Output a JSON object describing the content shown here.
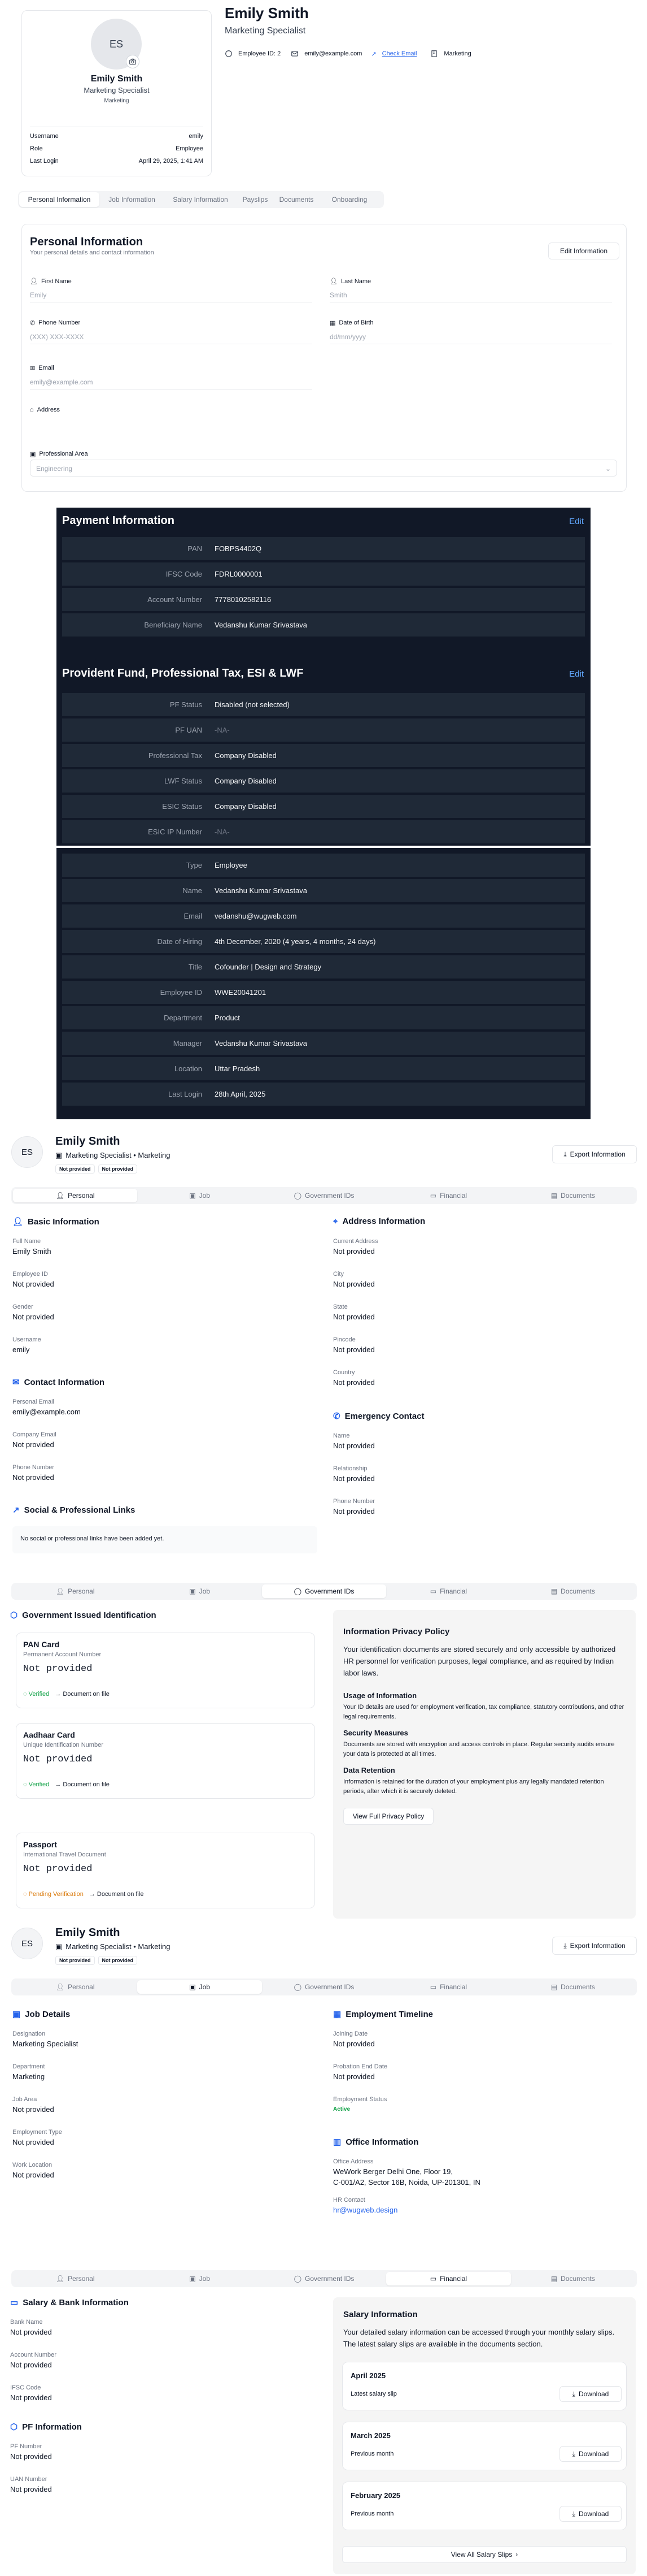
{
  "profile_card": {
    "initials": "ES",
    "name": "Emily Smith",
    "role": "Marketing Specialist",
    "department": "Marketing",
    "rows": [
      {
        "k": "Username",
        "v": "emily"
      },
      {
        "k": "Role",
        "v": "Employee"
      },
      {
        "k": "Last Login",
        "v": "April 29, 2025, 1:41 AM"
      }
    ]
  },
  "header": {
    "name": "Emily Smith",
    "role": "Marketing Specialist",
    "employee_id": "Employee ID: 2",
    "email": "emily@example.com",
    "check_email": "Check Email",
    "department": "Marketing"
  },
  "tabs1": [
    "Personal Information",
    "Job Information",
    "Salary Information",
    "Payslips",
    "Documents",
    "Onboarding"
  ],
  "personal_form": {
    "title": "Personal Information",
    "subtitle": "Your personal details and contact information",
    "edit": "Edit Information",
    "first_name_label": "First Name",
    "first_name": "Emily",
    "last_name_label": "Last Name",
    "last_name": "Smith",
    "phone_label": "Phone Number",
    "phone_placeholder": "(XXX) XXX-XXXX",
    "dob_label": "Date of Birth",
    "dob_placeholder": "dd/mm/yyyy",
    "email_label": "Email",
    "email": "emily@example.com",
    "address_label": "Address",
    "area_label": "Professional Area",
    "area": "Engineering"
  },
  "payment": {
    "title": "Payment Information",
    "edit": "Edit",
    "rows": [
      {
        "k": "PAN",
        "v": "FOBPS4402Q"
      },
      {
        "k": "IFSC Code",
        "v": "FDRL0000001"
      },
      {
        "k": "Account Number",
        "v": "77780102582116"
      },
      {
        "k": "Beneficiary Name",
        "v": "Vedanshu Kumar Srivastava"
      }
    ]
  },
  "pf": {
    "title": "Provident Fund, Professional Tax, ESI & LWF",
    "edit": "Edit",
    "rows": [
      {
        "k": "PF Status",
        "v": "Disabled (not selected)"
      },
      {
        "k": "PF UAN",
        "v": "-NA-"
      },
      {
        "k": "Professional Tax",
        "v": "Company Disabled"
      },
      {
        "k": "LWF Status",
        "v": "Company Disabled"
      },
      {
        "k": "ESIC Status",
        "v": "Company Disabled"
      },
      {
        "k": "ESIC IP Number",
        "v": "-NA-"
      }
    ]
  },
  "employee": {
    "rows": [
      {
        "k": "Type",
        "v": "Employee"
      },
      {
        "k": "Name",
        "v": "Vedanshu Kumar Srivastava"
      },
      {
        "k": "Email",
        "v": "vedanshu@wugweb.com"
      },
      {
        "k": "Date of Hiring",
        "v": "4th December, 2020 (4 years, 4 months, 24 days)"
      },
      {
        "k": "Title",
        "v": "Cofounder | Design and Strategy"
      },
      {
        "k": "Employee ID",
        "v": "WWE20041201"
      },
      {
        "k": "Department",
        "v": "Product"
      },
      {
        "k": "Manager",
        "v": "Vedanshu Kumar Srivastava"
      },
      {
        "k": "Location",
        "v": "Uttar Pradesh"
      },
      {
        "k": "Last Login",
        "v": "28th April, 2025"
      }
    ]
  },
  "mini_header": {
    "initials": "ES",
    "name": "Emily Smith",
    "subtitle": "Marketing Specialist • Marketing",
    "badge1": "Not provided",
    "badge2": "Not provided",
    "export": "Export Information"
  },
  "tabs2": [
    "Personal",
    "Job",
    "Government IDs",
    "Financial",
    "Documents"
  ],
  "basic": {
    "title": "Basic Information",
    "fields": [
      {
        "k": "Full Name",
        "v": "Emily Smith"
      },
      {
        "k": "Employee ID",
        "v": "Not provided"
      },
      {
        "k": "Gender",
        "v": "Not provided"
      },
      {
        "k": "Username",
        "v": "emily"
      }
    ]
  },
  "address": {
    "title": "Address Information",
    "fields": [
      {
        "k": "Current Address",
        "v": "Not provided"
      },
      {
        "k": "City",
        "v": "Not provided"
      },
      {
        "k": "State",
        "v": "Not provided"
      },
      {
        "k": "Pincode",
        "v": "Not provided"
      },
      {
        "k": "Country",
        "v": "Not provided"
      }
    ]
  },
  "contact": {
    "title": "Contact Information",
    "fields": [
      {
        "k": "Personal Email",
        "v": "emily@example.com"
      },
      {
        "k": "Company Email",
        "v": "Not provided"
      },
      {
        "k": "Phone Number",
        "v": "Not provided"
      }
    ]
  },
  "emergency": {
    "title": "Emergency Contact",
    "fields": [
      {
        "k": "Name",
        "v": "Not provided"
      },
      {
        "k": "Relationship",
        "v": "Not provided"
      },
      {
        "k": "Phone Number",
        "v": "Not provided"
      }
    ]
  },
  "social": {
    "title": "Social & Professional Links",
    "empty": "No social or professional links have been added yet."
  },
  "gov": {
    "title": "Government Issued Identification",
    "cards": [
      {
        "title": "PAN Card",
        "sub": "Permanent Account Number",
        "value": "Not provided",
        "status": "Verified",
        "doc": "Document on file"
      },
      {
        "title": "Aadhaar Card",
        "sub": "Unique Identification Number",
        "value": "Not provided",
        "status": "Verified",
        "doc": "Document on file"
      },
      {
        "title": "Passport",
        "sub": "International Travel Document",
        "value": "Not provided",
        "status": "Pending Verification",
        "doc": "Document on file"
      }
    ],
    "privacy_title": "Information Privacy Policy",
    "privacy_text": "Your identification documents are stored securely and only accessible by authorized HR personnel for verification purposes, legal compliance, and as required by Indian labor laws.",
    "p1_title": "Usage of Information",
    "p1_text": "Your ID details are used for employment verification, tax compliance, statutory contributions, and other legal requirements.",
    "p2_title": "Security Measures",
    "p2_text": "Documents are stored with encryption and access controls in place. Regular security audits ensure your data is protected at all times.",
    "p3_title": "Data Retention",
    "p3_text": "Information is retained for the duration of your employment plus any legally mandated retention periods, after which it is securely deleted.",
    "privacy_button": "View Full Privacy Policy"
  },
  "job": {
    "title": "Job Details",
    "fields": [
      {
        "k": "Designation",
        "v": "Marketing Specialist"
      },
      {
        "k": "Department",
        "v": "Marketing"
      },
      {
        "k": "Job Area",
        "v": "Not provided"
      },
      {
        "k": "Employment Type",
        "v": "Not provided"
      },
      {
        "k": "Work Location",
        "v": "Not provided"
      }
    ]
  },
  "timeline": {
    "title": "Employment Timeline",
    "fields": [
      {
        "k": "Joining Date",
        "v": "Not provided"
      },
      {
        "k": "Probation End Date",
        "v": "Not provided"
      }
    ],
    "status_label": "Employment Status",
    "status": "Active"
  },
  "office": {
    "title": "Office Information",
    "address_label": "Office Address",
    "address1": "WeWork Berger Delhi One, Floor 19,",
    "address2": "C-001/A2, Sector 16B, Noida, UP-201301, IN",
    "hr_label": "HR Contact",
    "hr": "hr@wugweb.design"
  },
  "salary": {
    "title": "Salary & Bank Information",
    "fields": [
      {
        "k": "Bank Name",
        "v": "Not provided"
      },
      {
        "k": "Account Number",
        "v": "Not provided"
      },
      {
        "k": "IFSC Code",
        "v": "Not provided"
      }
    ]
  },
  "pfinfo": {
    "title": "PF Information",
    "fields": [
      {
        "k": "PF Number",
        "v": "Not provided"
      },
      {
        "k": "UAN Number",
        "v": "Not provided"
      }
    ]
  },
  "salary_info": {
    "title": "Salary Information",
    "text": "Your detailed salary information can be accessed through your monthly salary slips. The latest salary slips are available in the documents section.",
    "slips": [
      {
        "month": "April 2025",
        "sub": "Latest salary slip"
      },
      {
        "month": "March 2025",
        "sub": "Previous month"
      },
      {
        "month": "February 2025",
        "sub": "Previous month"
      }
    ],
    "download": "Download",
    "view_all": "View All Salary Slips"
  }
}
